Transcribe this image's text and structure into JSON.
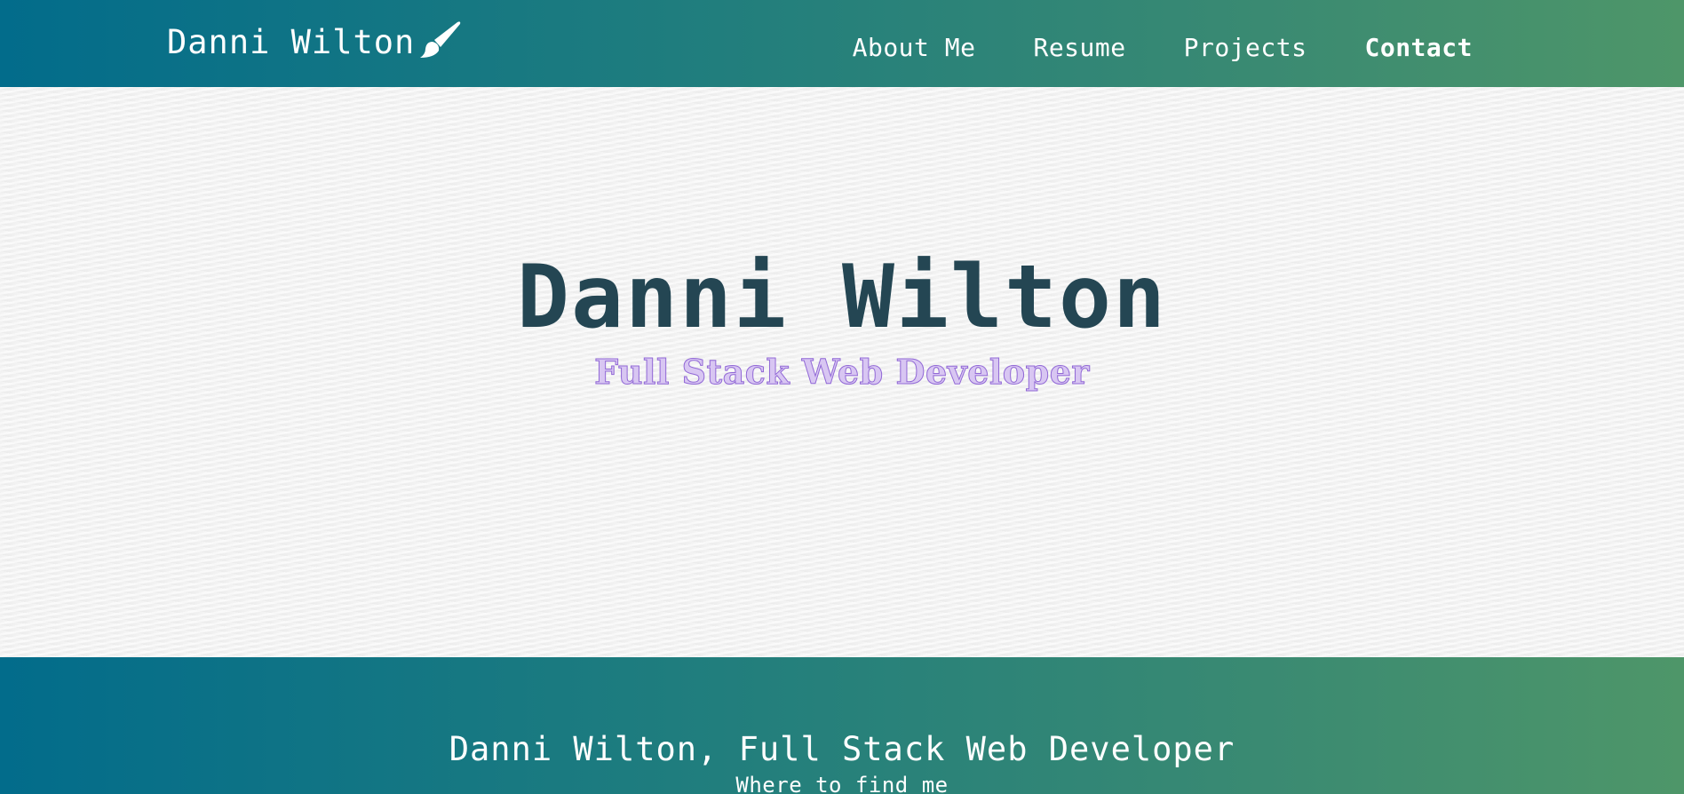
{
  "navbar": {
    "brand_label": "Danni Wilton",
    "brand_icon": "paintbrush-icon",
    "links": [
      {
        "label": "About Me"
      },
      {
        "label": "Resume"
      },
      {
        "label": "Projects"
      },
      {
        "label": "Contact",
        "active": true
      }
    ]
  },
  "hero": {
    "title": "Danni Wilton",
    "subtitle": "Full Stack Web Developer"
  },
  "footer": {
    "title": "Danni Wilton, Full Stack Web Developer",
    "subtitle": "Where to find me"
  },
  "colors": {
    "gradient_start": "#026c8b",
    "gradient_end": "#4e9669",
    "hero_title": "#244653",
    "subtitle_accent": "#9168d6",
    "hero_background": "#f3f3f3"
  }
}
